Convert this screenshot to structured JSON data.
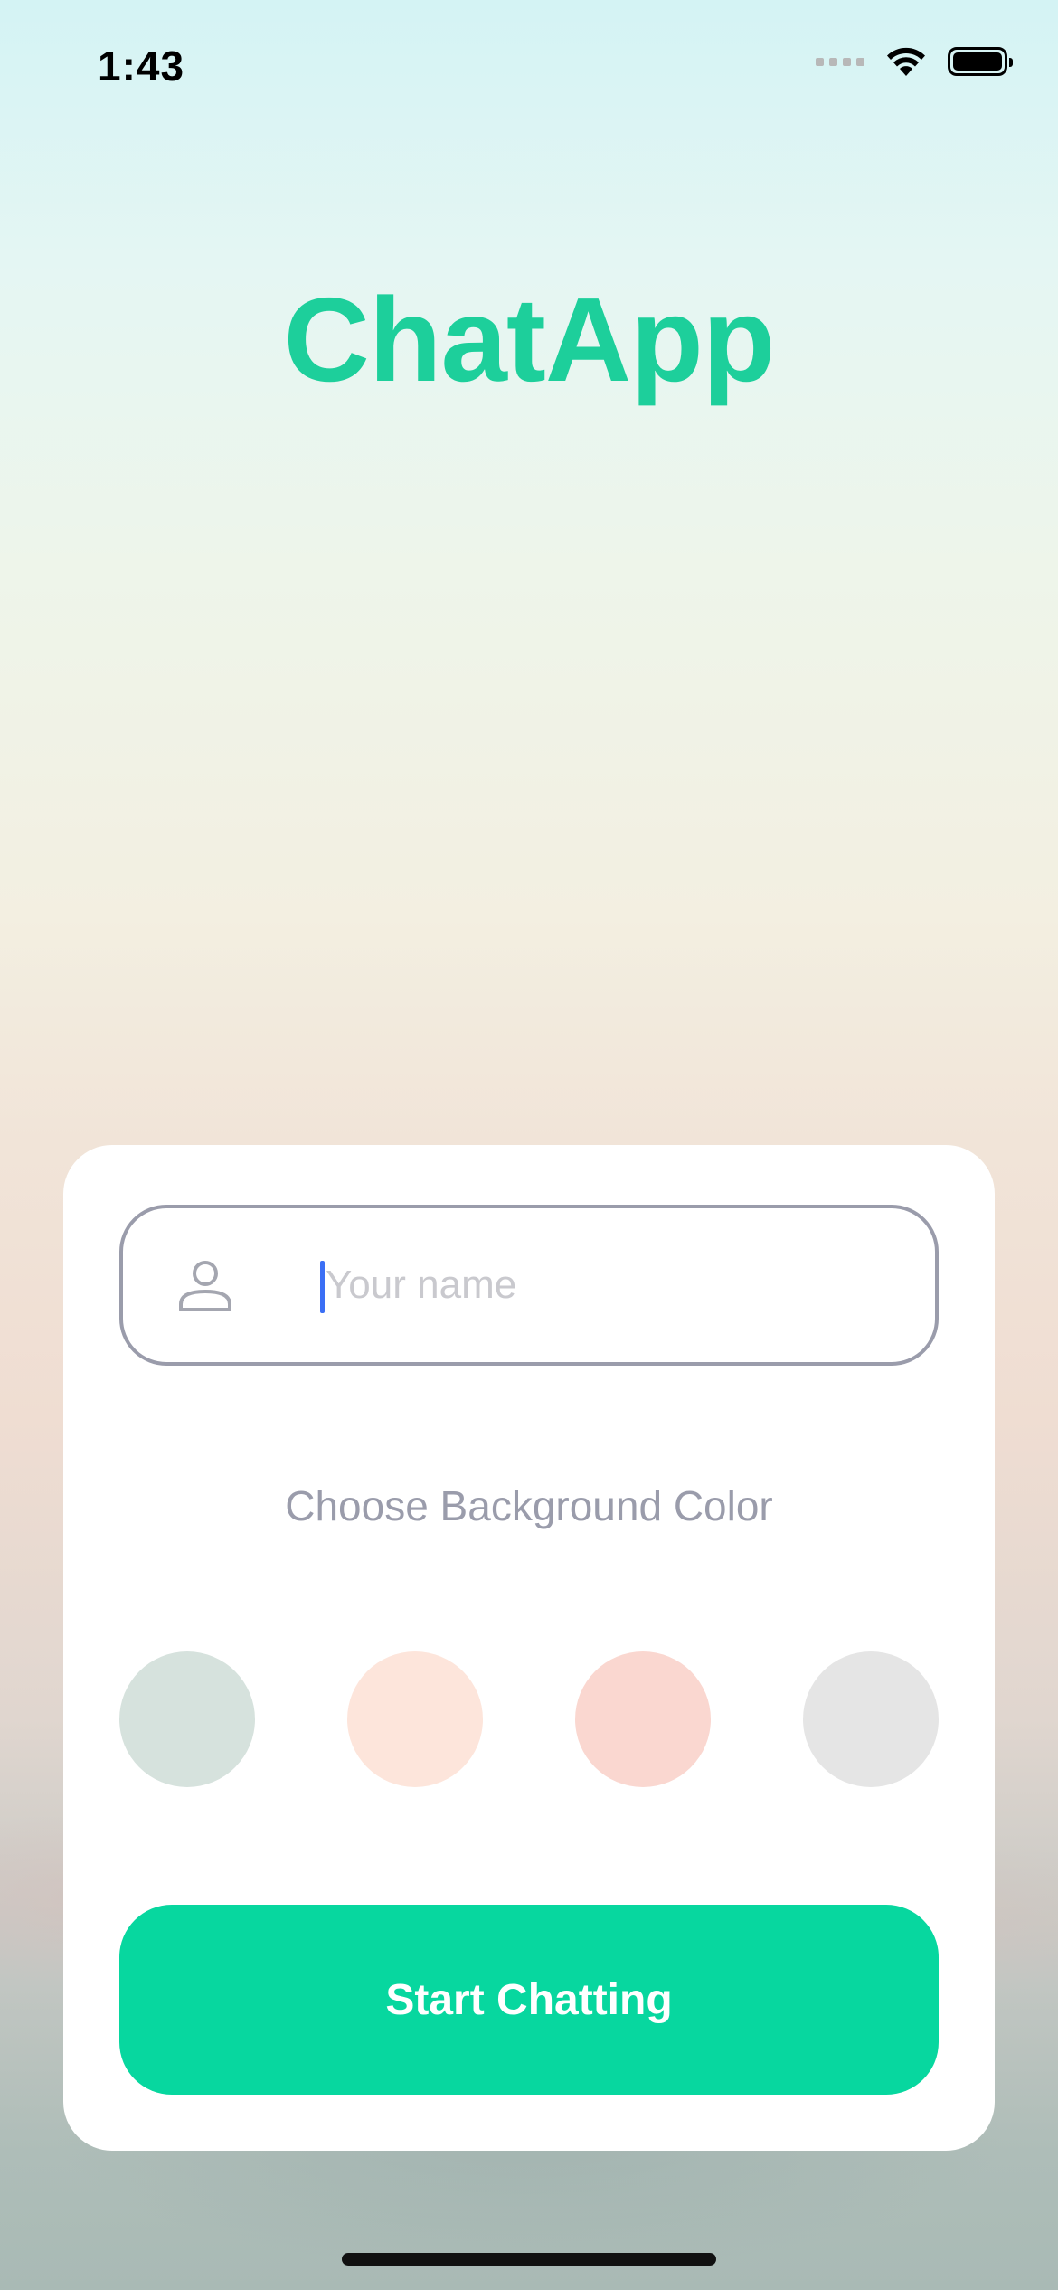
{
  "status_bar": {
    "time": "1:43",
    "icons": [
      "cellular-signal-icon",
      "wifi-icon",
      "battery-icon"
    ]
  },
  "app": {
    "title": "ChatApp",
    "accent_color": "#1dcf9b"
  },
  "form": {
    "name_placeholder": "Your name",
    "name_value": "",
    "name_icon": "person-icon",
    "color_label": "Choose Background Color",
    "colors": [
      "#d6e2dd",
      "#fde5db",
      "#fad7d0",
      "#e5e5e5"
    ],
    "start_button_label": "Start Chatting",
    "start_button_color": "#07d79f"
  }
}
